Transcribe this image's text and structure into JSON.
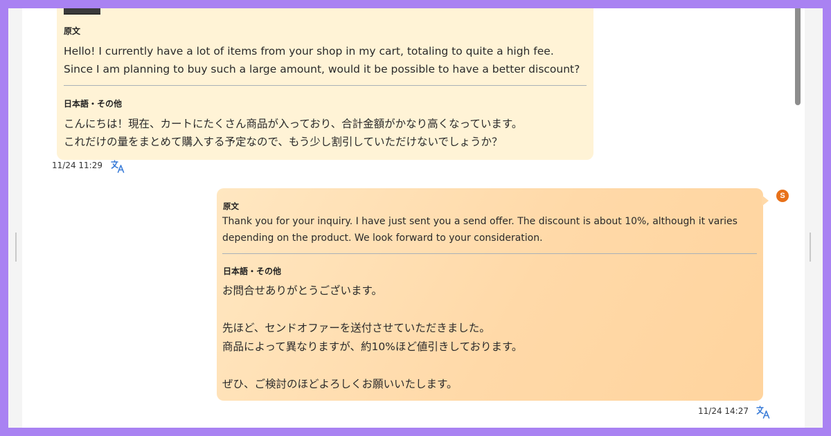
{
  "incoming": {
    "original_label": "原文",
    "original_text": "Hello! I currently have a lot of items from your shop in my cart, totaling to quite a high fee.\nSince I am planning to buy such a large amount, would it be possible to have a better discount?",
    "translation_label": "日本語・その他",
    "translation_text": "こんにちは！現在、カートにたくさん商品が入っており、合計金額がかなり高くなっています。\nこれだけの量をまとめて購入する予定なので、もう少し割引していただけないでしょうか？",
    "timestamp": "11/24 11:29",
    "translate_icon": "translate-icon"
  },
  "outgoing": {
    "badge": "S",
    "original_label": "原文",
    "original_text": "Thank you for your inquiry. I have just sent you a send offer. The discount is about 10%, although it varies\ndepending on the product. We look forward to your consideration.",
    "translation_label": "日本語・その他",
    "translation_text": "お問合せありがとうございます。\n\n先ほど、センドオファーを送付させていただきました。\n商品によって異なりますが、約10%ほど値引きしております。\n\nぜひ、ご検討のほどよろしくお願いいたします。",
    "timestamp": "11/24 14:27",
    "translate_icon": "translate-icon"
  },
  "colors": {
    "frame": "#a982f2",
    "incoming_bubble": "#fff3d6",
    "outgoing_bubble": "#ffd9a8",
    "badge": "#e8711a",
    "icon_blue": "#3b7dd8"
  }
}
